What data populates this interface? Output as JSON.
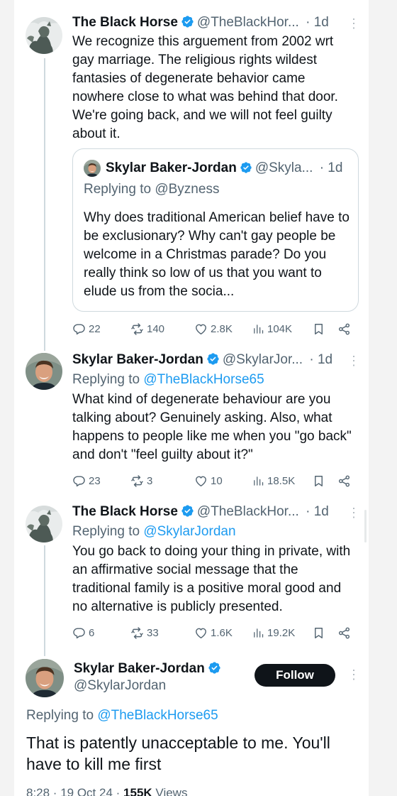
{
  "posts": [
    {
      "author": "The Black Horse",
      "handle": "@TheBlackHor...",
      "time": "· 1d",
      "text": "We recognize this arguement from 2002 wrt gay marriage. The religious rights wildest fantasies of degenerate behavior came nowhere close to what was behind that door. We're going back, and we will not feel guilty about it.",
      "quote": {
        "author": "Skylar Baker-Jordan",
        "handle": "@Skyla...",
        "time": "· 1d",
        "replying_prefix": "Replying to",
        "replying_to": "@Byzness",
        "text": "Why does traditional American belief have to be exclusionary? Why can't gay people be welcome in a Christmas parade? Do you really think so low of us that you want to elude us from the socia..."
      },
      "stats": {
        "replies": "22",
        "reposts": "140",
        "likes": "2.8K",
        "views": "104K"
      }
    },
    {
      "author": "Skylar Baker-Jordan",
      "handle": "@SkylarJor...",
      "time": "· 1d",
      "replying_prefix": "Replying to",
      "replying_to": "@TheBlackHorse65",
      "text": "What kind of degenerate behaviour are you talking about? Genuinely asking. Also, what happens to people like me when you \"go back\" and don't \"feel guilty about it?\"",
      "stats": {
        "replies": "23",
        "reposts": "3",
        "likes": "10",
        "views": "18.5K"
      }
    },
    {
      "author": "The Black Horse",
      "handle": "@TheBlackHor...",
      "time": "· 1d",
      "replying_prefix": "Replying to",
      "replying_to": "@SkylarJordan",
      "text": "You go back to doing your thing in private, with an affirmative social message that the traditional family is a positive moral good and no alternative is publicly presented.",
      "stats": {
        "replies": "6",
        "reposts": "33",
        "likes": "1.6K",
        "views": "19.2K"
      }
    }
  ],
  "main_post": {
    "author": "Skylar Baker-Jordan",
    "handle": "@SkylarJordan",
    "follow_label": "Follow",
    "replying_prefix": "Replying to",
    "replying_to": "@TheBlackHorse65",
    "text": "That is patently unacceptable to me. You'll have to kill me first",
    "time": "8:28 · 19 Oct 24 ·",
    "views_count": "155K",
    "views_label": "Views"
  },
  "more_glyph": "⋮",
  "icons": {
    "reply": "reply-icon",
    "repost": "repost-icon",
    "like": "like-icon",
    "views": "views-icon",
    "bookmark": "bookmark-icon",
    "share": "share-icon",
    "verified": "verified-badge-icon",
    "more": "more-options-icon"
  },
  "colors": {
    "text": "#0f1419",
    "muted": "#536471",
    "link": "#1d9bf0",
    "verified": "#1d9bf0",
    "follow_bg": "#0f1419",
    "border": "#cfd9de"
  }
}
